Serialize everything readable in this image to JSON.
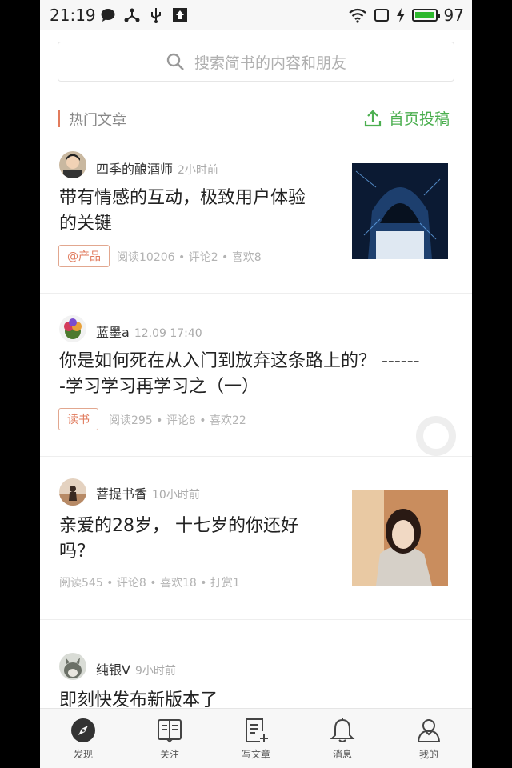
{
  "status_bar": {
    "time": "21:19",
    "battery": "97"
  },
  "search": {
    "placeholder": "搜索简书的内容和朋友"
  },
  "section": {
    "title": "热门文章",
    "post_button": "首页投稿"
  },
  "articles": [
    {
      "author": "四季的酿酒师",
      "time": "2小时前",
      "title_line1": "带有情感的互动，极致用户体验",
      "title_line2": "的关键",
      "tag": "@产品",
      "meta": "阅读10206 • 评论2 • 喜欢8"
    },
    {
      "author": "蓝墨a",
      "time": "12.09 17:40",
      "title_line1": "你是如何死在从入门到放弃这条路上的？ ------",
      "title_line2": "-学习学习再学习之（一）",
      "tag": "读书",
      "meta": "阅读295 • 评论8 • 喜欢22"
    },
    {
      "author": "菩提书香",
      "time": "10小时前",
      "title_line1": "亲爱的28岁， 十七岁的你还好",
      "title_line2": "吗？",
      "meta": "阅读545 • 评论8 • 喜欢18 • 打赏1"
    },
    {
      "author": "纯银V",
      "time": "9小时前",
      "title_line1": "即刻快发布新版本了"
    }
  ],
  "tabs": [
    {
      "label": "发现",
      "icon": "compass-icon"
    },
    {
      "label": "关注",
      "icon": "book-icon"
    },
    {
      "label": "写文章",
      "icon": "write-icon"
    },
    {
      "label": "消息",
      "icon": "bell-icon"
    },
    {
      "label": "我的",
      "icon": "person-icon"
    }
  ]
}
